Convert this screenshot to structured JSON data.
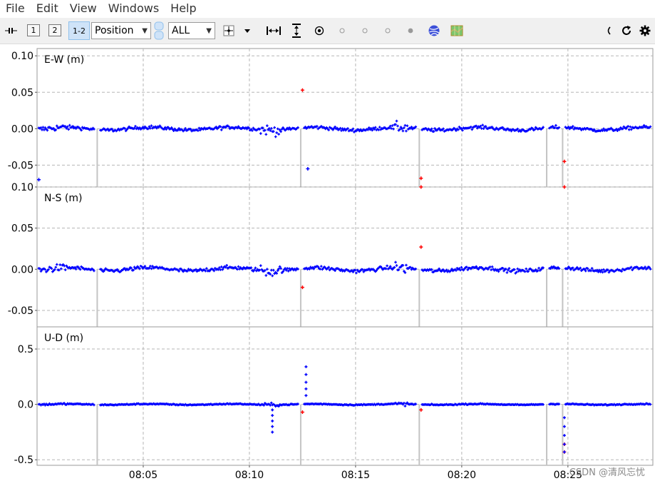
{
  "menu": {
    "items": [
      "File",
      "Edit",
      "View",
      "Windows",
      "Help"
    ]
  },
  "toolbar": {
    "plot_1_label": "1",
    "plot_2_label": "2",
    "plot_12_label": "1-2",
    "plot_type": "Position",
    "satellite_filter": "ALL",
    "icons": [
      "split-icon",
      "center-icon",
      "dropdown-icon",
      "fit-horizontal-icon",
      "fit-vertical-icon",
      "show-origin-icon",
      "solution-1-icon",
      "solution-2-icon",
      "solution-3-icon",
      "solution-4-icon",
      "globe-icon",
      "map-icon",
      "back-icon",
      "reload-icon",
      "settings-icon"
    ]
  },
  "watermark": "CSDN @清风忘忧",
  "chart_data": [
    {
      "type": "scatter",
      "ylabel": "E-W (m)",
      "ylim": [
        -0.08,
        0.11
      ],
      "yticks": [
        "0.10",
        "0.05",
        "0.00",
        "-0.05"
      ],
      "ytick_values": [
        0.1,
        0.05,
        0.0,
        -0.05
      ],
      "grid": true,
      "series": [
        {
          "color": "#0000ff",
          "baseline": 0.0,
          "noise": 0.004
        },
        {
          "color": "#ff0000"
        }
      ],
      "outliers": [
        {
          "x": "08:12:30",
          "y": 0.053,
          "color": "#ff0000"
        },
        {
          "x": "08:12:45",
          "y": -0.055,
          "color": "#0000ff"
        },
        {
          "x": "08:18:05",
          "y": -0.068,
          "color": "#ff0000"
        },
        {
          "x": "08:24:50",
          "y": -0.045,
          "color": "#ff0000"
        },
        {
          "x": "08:00:05",
          "y": -0.07,
          "color": "#0000ff"
        }
      ]
    },
    {
      "type": "scatter",
      "ylabel": "N-S (m)",
      "ylim": [
        -0.07,
        0.1
      ],
      "yticks": [
        "0.10",
        "0.05",
        "0.00",
        "-0.05"
      ],
      "ytick_values": [
        0.1,
        0.05,
        0.0,
        -0.05
      ],
      "grid": true,
      "series": [
        {
          "color": "#0000ff",
          "baseline": 0.0,
          "noise": 0.004
        },
        {
          "color": "#ff0000"
        }
      ],
      "outliers": [
        {
          "x": "08:12:30",
          "y": -0.022,
          "color": "#ff0000"
        },
        {
          "x": "08:18:05",
          "y": 0.1,
          "color": "#ff0000"
        },
        {
          "x": "08:18:05",
          "y": 0.027,
          "color": "#ff0000"
        },
        {
          "x": "08:24:50",
          "y": 0.1,
          "color": "#ff0000"
        }
      ]
    },
    {
      "type": "scatter",
      "ylabel": "U-D (m)",
      "ylim": [
        -0.55,
        0.7
      ],
      "yticks": [
        "0.5",
        "0.0",
        "-0.5"
      ],
      "ytick_values": [
        0.5,
        0.0,
        -0.5
      ],
      "grid": true,
      "xticks": [
        "08:05",
        "08:10",
        "08:15",
        "08:20",
        "08:25"
      ],
      "series": [
        {
          "color": "#0000ff",
          "baseline": 0.0,
          "noise": 0.008
        },
        {
          "color": "#ff0000"
        }
      ],
      "outliers": [
        {
          "x": "08:12:30",
          "y": -0.07,
          "color": "#ff0000"
        },
        {
          "x": "08:18:05",
          "y": -0.05,
          "color": "#ff0000"
        },
        {
          "x": "08:24:50",
          "y": -0.36,
          "color": "#ff0000"
        },
        {
          "x": "08:24:50",
          "y": -0.43,
          "color": "#ff0000"
        }
      ]
    }
  ],
  "time_axis": {
    "start": "08:00:00",
    "end": "08:29:00",
    "ticks": [
      "08:05",
      "08:10",
      "08:15",
      "08:20",
      "08:25"
    ]
  },
  "data_gaps": [
    "08:02:50",
    "08:12:25",
    "08:18:00",
    "08:24:00",
    "08:24:45"
  ]
}
